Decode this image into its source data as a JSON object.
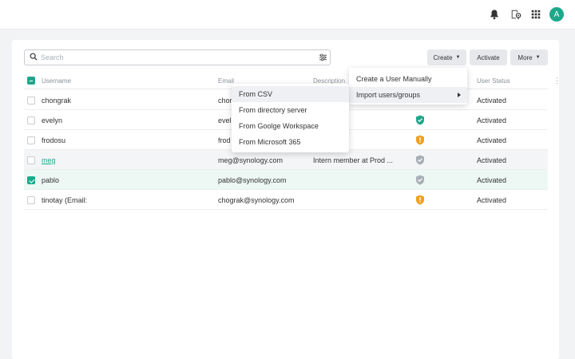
{
  "topbar": {
    "icons": [
      "bell-icon",
      "device-location-icon",
      "apps-grid-icon"
    ],
    "avatar_initial": "A"
  },
  "search": {
    "placeholder": "Search"
  },
  "toolbar": {
    "create_label": "Create",
    "activate_label": "Activate",
    "more_label": "More"
  },
  "table": {
    "columns": [
      "Username",
      "Email",
      "Description",
      "User Status"
    ],
    "rows": [
      {
        "username": "chongrak",
        "email": "chor",
        "description": "",
        "status": "Activated",
        "checked": false,
        "shield": ""
      },
      {
        "username": "evelyn",
        "email": "evel",
        "description": "",
        "status": "Activated",
        "checked": false,
        "shield": "green"
      },
      {
        "username": "frodosu",
        "email": "frod",
        "description": "",
        "status": "Activated",
        "checked": false,
        "shield": "orange"
      },
      {
        "username": "meg",
        "email": "meg@synology.com",
        "description": "Intern member at Prod ...",
        "status": "Activated",
        "checked": false,
        "shield": "gray"
      },
      {
        "username": "pablo",
        "email": "pablo@synology.com",
        "description": "",
        "status": "Activated",
        "checked": true,
        "shield": "gray"
      },
      {
        "username": "tinotay (Email:",
        "email": "chograk@synology.com",
        "description": "",
        "status": "Activated",
        "checked": false,
        "shield": "orange"
      }
    ]
  },
  "create_menu": {
    "items": [
      "Create a User Manually",
      "Import users/groups"
    ]
  },
  "import_menu": {
    "items": [
      "From CSV",
      "From directory server",
      "From Goolge Workspace",
      "From Microsoft 365"
    ]
  },
  "colors": {
    "accent": "#1ea88a",
    "shield_green": "#1ea88a",
    "shield_orange": "#f0a020",
    "shield_gray": "#a9afb6"
  }
}
